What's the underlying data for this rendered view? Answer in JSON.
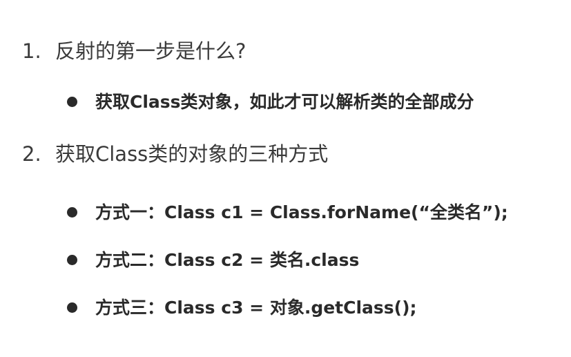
{
  "sections": [
    {
      "number": "1.",
      "title": "反射的第一步是什么?",
      "bullets": [
        "获取Class类对象，如此才可以解析类的全部成分"
      ]
    },
    {
      "number": "2.",
      "title": "获取Class类的对象的三种方式",
      "bullets": [
        "方式一：Class c1 = Class.forName(“全类名”);",
        "方式二：Class c2 = 类名.class",
        "方式三：Class c3 = 对象.getClass();"
      ]
    }
  ]
}
